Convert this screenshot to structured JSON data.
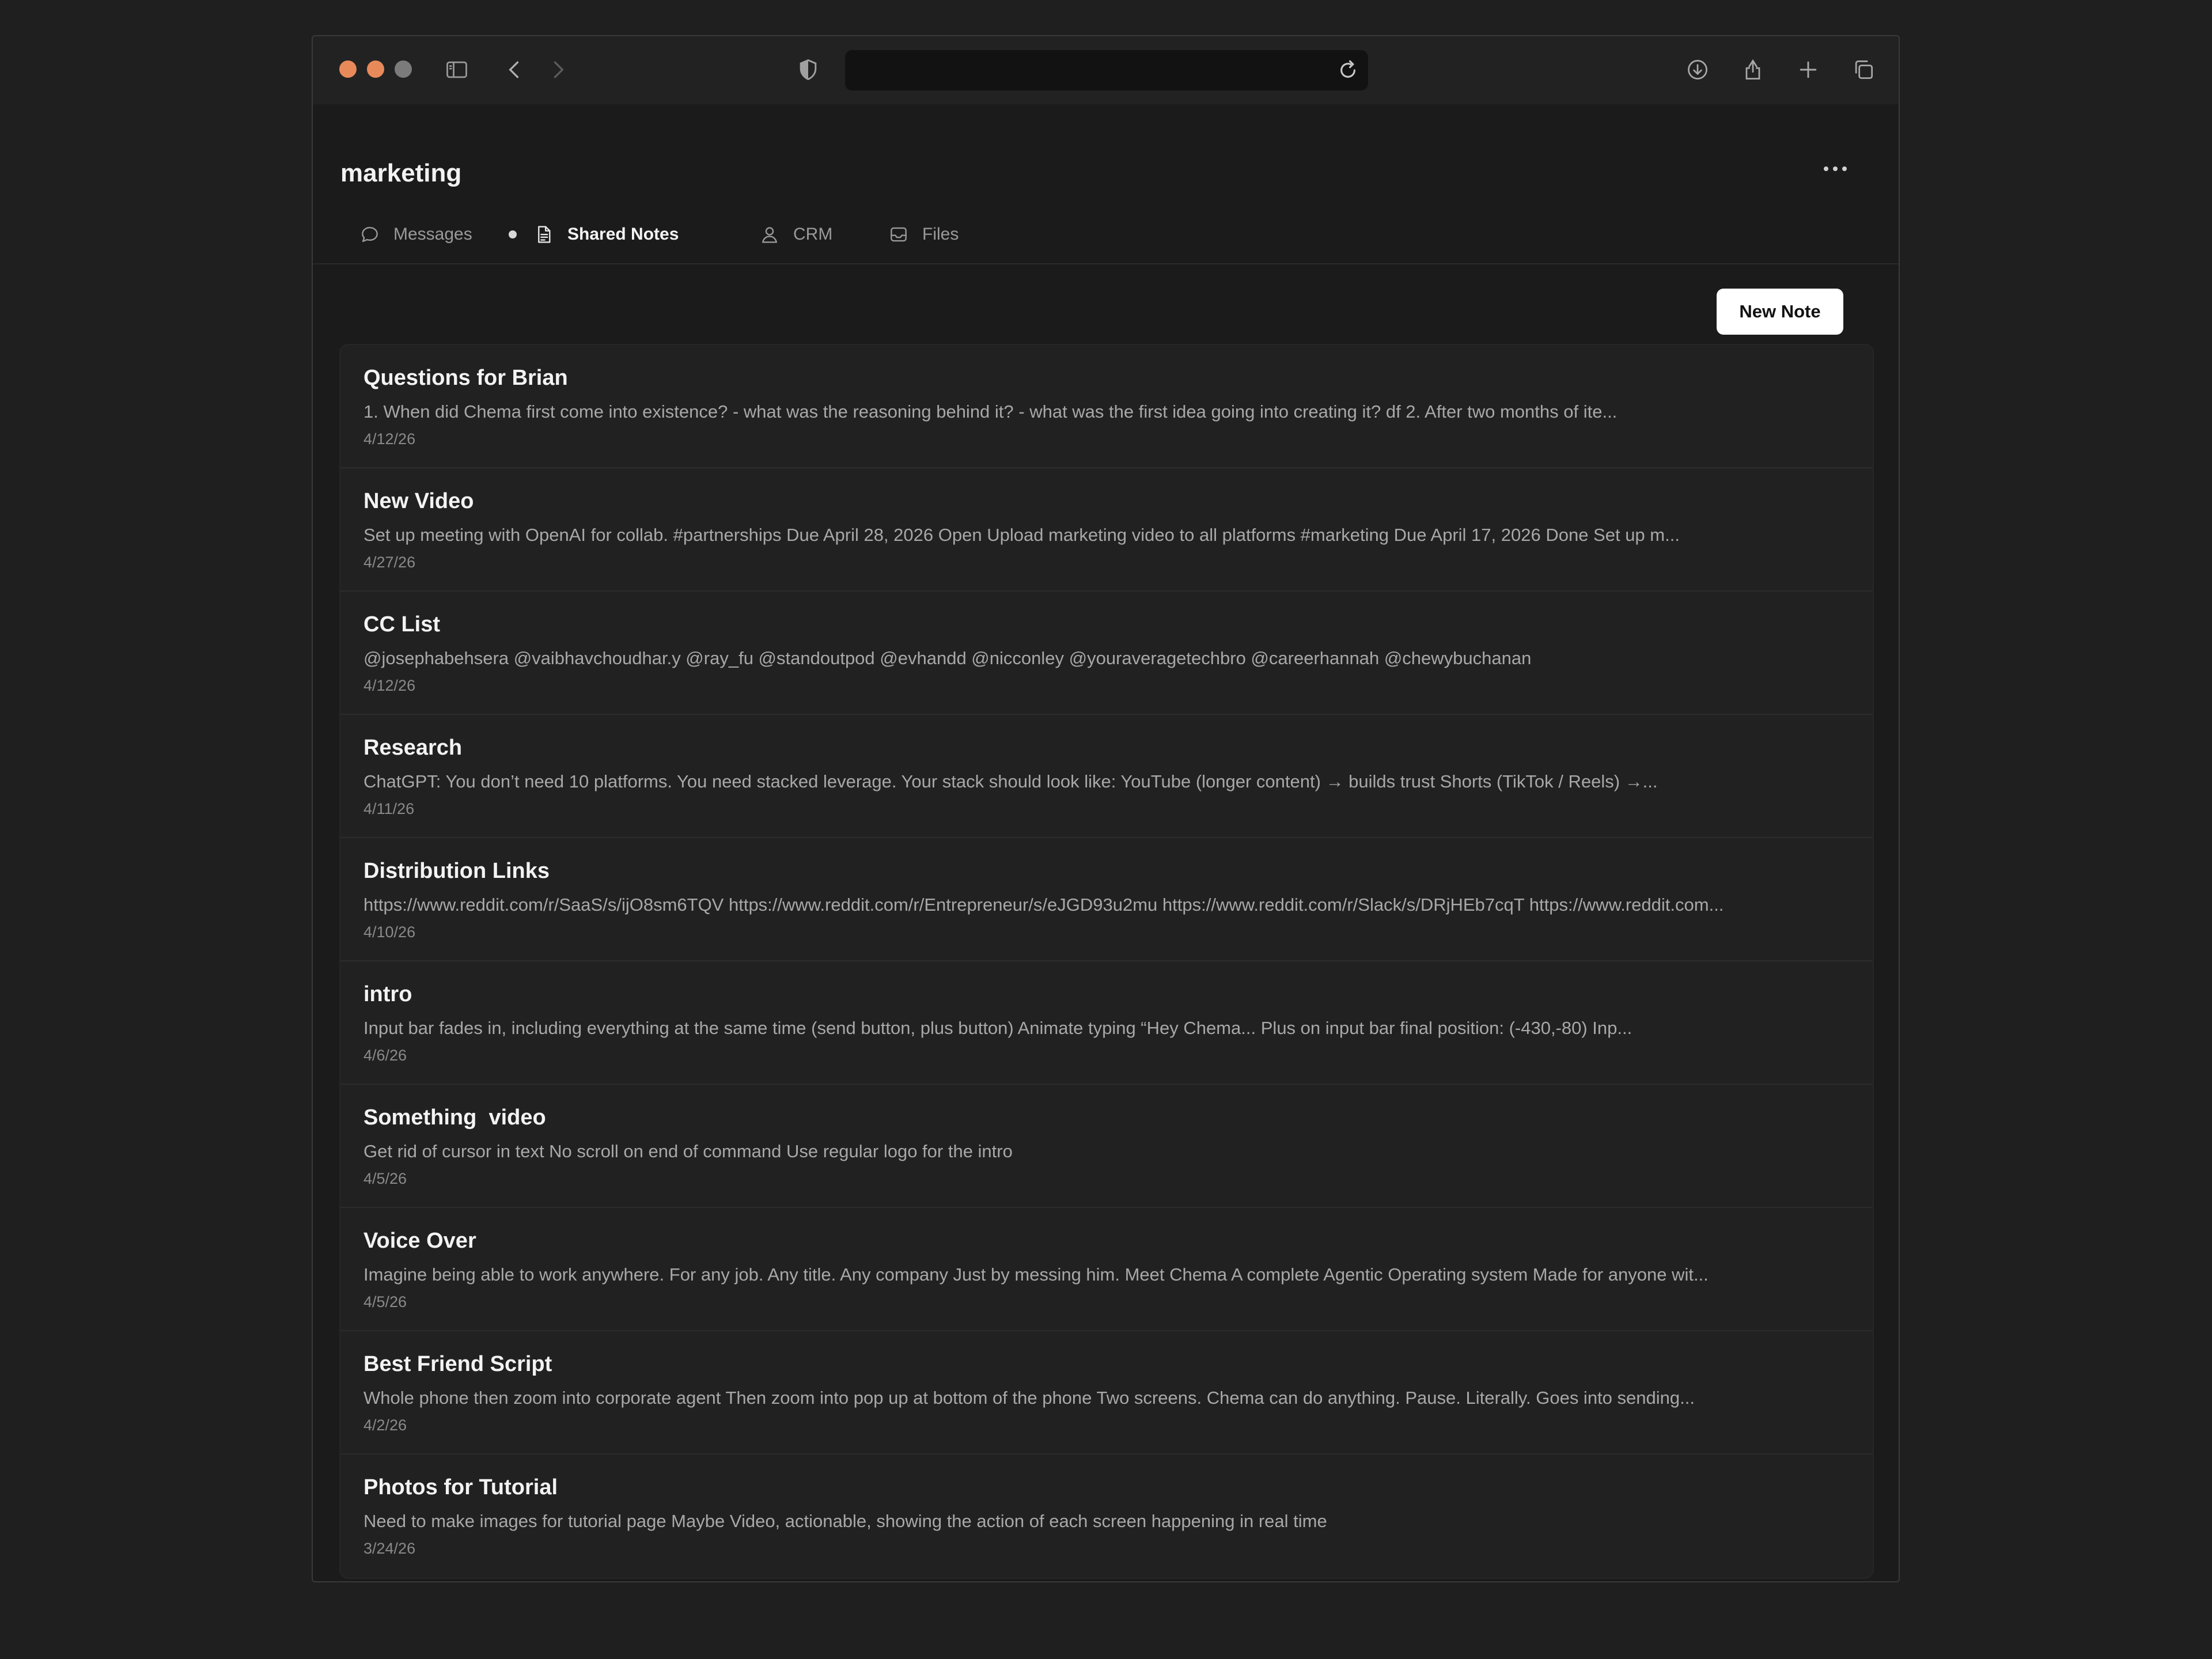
{
  "browser": {
    "address_value": "",
    "icons": [
      "sidebar-icon",
      "back-icon",
      "forward-icon",
      "shield-icon",
      "reload-icon",
      "download-icon",
      "share-icon",
      "plus-icon",
      "tabs-icon"
    ]
  },
  "channel": {
    "title": "marketing"
  },
  "tabs": [
    {
      "label": "Messages",
      "icon": "chat-bubble-icon",
      "active": false
    },
    {
      "label": "Shared Notes",
      "icon": "document-icon",
      "active": true
    },
    {
      "label": "CRM",
      "icon": "person-icon",
      "active": false
    },
    {
      "label": "Files",
      "icon": "inbox-tray-icon",
      "active": false
    }
  ],
  "toolbar": {
    "new_note_label": "New Note"
  },
  "notes": [
    {
      "title": "Questions for Brian",
      "preview": "1. When did Chema first come into existence? - what was the reasoning behind it? - what was the first idea going into creating it? df 2. After two months of ite...",
      "date": "4/12/26"
    },
    {
      "title": "New Video",
      "preview": "Set up meeting with OpenAI for collab. #partnerships Due April 28, 2026 Open Upload marketing video to all platforms #marketing Due April 17, 2026 Done Set up m...",
      "date": "4/27/26"
    },
    {
      "title": "CC List",
      "preview": "@josephabehsera @vaibhavchoudhar.y @ray_fu @standoutpod @evhandd @nicconley @youraveragetechbro @careerhannah @chewybuchanan",
      "date": "4/12/26"
    },
    {
      "title": "Research",
      "preview": "ChatGPT: You don’t need 10 platforms. You need stacked leverage. Your stack should look like: YouTube (longer content) → builds trust Shorts (TikTok / Reels) →...",
      "date": "4/11/26"
    },
    {
      "title": "Distribution Links",
      "preview": "https://www.reddit.com/r/SaaS/s/ijO8sm6TQV https://www.reddit.com/r/Entrepreneur/s/eJGD93u2mu https://www.reddit.com/r/Slack/s/DRjHEb7cqT https://www.reddit.com...",
      "date": "4/10/26"
    },
    {
      "title": "intro",
      "preview": "Input bar fades in, including everything at the same time (send button, plus button) Animate typing “Hey Chema... Plus on input bar final position: (-430,-80) Inp...",
      "date": "4/6/26"
    },
    {
      "title": "Something  video",
      "preview": "Get rid of cursor in text No scroll on end of command Use regular logo for the intro",
      "date": "4/5/26"
    },
    {
      "title": "Voice Over",
      "preview": "Imagine being able to work anywhere. For any job. Any title. Any company Just by messing him. Meet Chema A complete Agentic Operating system Made for anyone wit...",
      "date": "4/5/26"
    },
    {
      "title": "Best Friend Script",
      "preview": "Whole phone then zoom into corporate agent Then zoom into pop up at bottom of the phone Two screens. Chema can do anything. Pause. Literally. Goes into sending...",
      "date": "4/2/26"
    },
    {
      "title": "Photos for Tutorial",
      "preview": "Need to make images for tutorial page Maybe Video, actionable, showing the action of each screen happening in real time",
      "date": "3/24/26"
    }
  ],
  "colors": {
    "window_bg": "#1b1b1b",
    "list_bg": "#212121",
    "traffic_close": "#e8895a",
    "traffic_min": "#e8895a",
    "traffic_max": "#7b7b7b",
    "button_bg": "#ffffff"
  }
}
